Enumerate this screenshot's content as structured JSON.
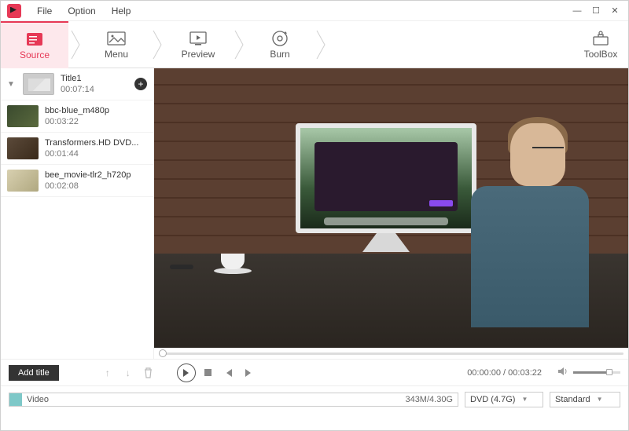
{
  "menu": {
    "file": "File",
    "option": "Option",
    "help": "Help"
  },
  "steps": {
    "source": "Source",
    "menu": "Menu",
    "preview": "Preview",
    "burn": "Burn",
    "toolbox": "ToolBox"
  },
  "titles": [
    {
      "name": "Title1",
      "duration": "00:07:14"
    },
    {
      "name": "bbc-blue_m480p",
      "duration": "00:03:22"
    },
    {
      "name": "Transformers.HD DVD...",
      "duration": "00:01:44"
    },
    {
      "name": "bee_movie-tlr2_h720p",
      "duration": "00:02:08"
    }
  ],
  "controls": {
    "add_title": "Add title",
    "time": "00:00:00 / 00:03:22"
  },
  "bottom": {
    "track_label": "Video",
    "size": "343M/4.30G",
    "disc": "DVD (4.7G)",
    "quality": "Standard"
  }
}
